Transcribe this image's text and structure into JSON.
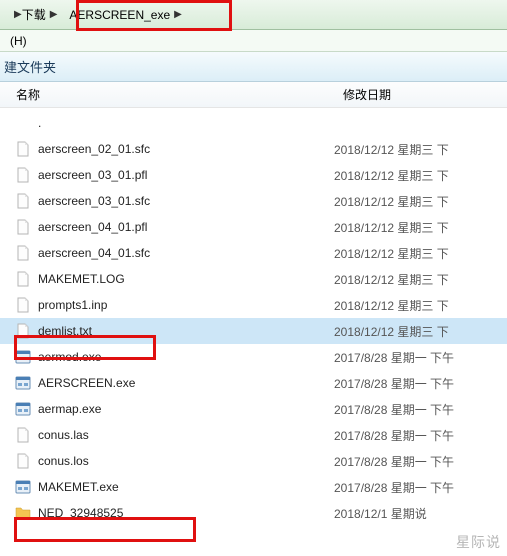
{
  "breadcrumb": {
    "items": [
      "下载",
      "AERSCREEN_exe"
    ]
  },
  "menu": {
    "help": "(H)"
  },
  "toolbar": {
    "new_folder": "建文件夹"
  },
  "columns": {
    "name": "名称",
    "date": "修改日期"
  },
  "files": [
    {
      "name": ".",
      "date": "",
      "icon": "dot",
      "selected": false
    },
    {
      "name": "aerscreen_02_01.sfc",
      "date": "2018/12/12 星期三 下",
      "icon": "file",
      "selected": false
    },
    {
      "name": "aerscreen_03_01.pfl",
      "date": "2018/12/12 星期三 下",
      "icon": "file",
      "selected": false
    },
    {
      "name": "aerscreen_03_01.sfc",
      "date": "2018/12/12 星期三 下",
      "icon": "file",
      "selected": false
    },
    {
      "name": "aerscreen_04_01.pfl",
      "date": "2018/12/12 星期三 下",
      "icon": "file",
      "selected": false
    },
    {
      "name": "aerscreen_04_01.sfc",
      "date": "2018/12/12 星期三 下",
      "icon": "file",
      "selected": false
    },
    {
      "name": "MAKEMET.LOG",
      "date": "2018/12/12 星期三 下",
      "icon": "file",
      "selected": false
    },
    {
      "name": "prompts1.inp",
      "date": "2018/12/12 星期三 下",
      "icon": "file",
      "selected": false
    },
    {
      "name": "demlist.txt",
      "date": "2018/12/12 星期三 下",
      "icon": "file",
      "selected": true
    },
    {
      "name": "aermod.exe",
      "date": "2017/8/28 星期一 下午",
      "icon": "exe",
      "selected": false
    },
    {
      "name": "AERSCREEN.exe",
      "date": "2017/8/28 星期一 下午",
      "icon": "exe",
      "selected": false
    },
    {
      "name": "aermap.exe",
      "date": "2017/8/28 星期一 下午",
      "icon": "exe",
      "selected": false
    },
    {
      "name": "conus.las",
      "date": "2017/8/28 星期一 下午",
      "icon": "file",
      "selected": false
    },
    {
      "name": "conus.los",
      "date": "2017/8/28 星期一 下午",
      "icon": "file",
      "selected": false
    },
    {
      "name": "MAKEMET.exe",
      "date": "2017/8/28 星期一 下午",
      "icon": "exe",
      "selected": false
    },
    {
      "name": "NED_32948525",
      "date": "2018/12/1   星期说",
      "icon": "folder",
      "selected": false
    }
  ],
  "watermark": "星际说"
}
